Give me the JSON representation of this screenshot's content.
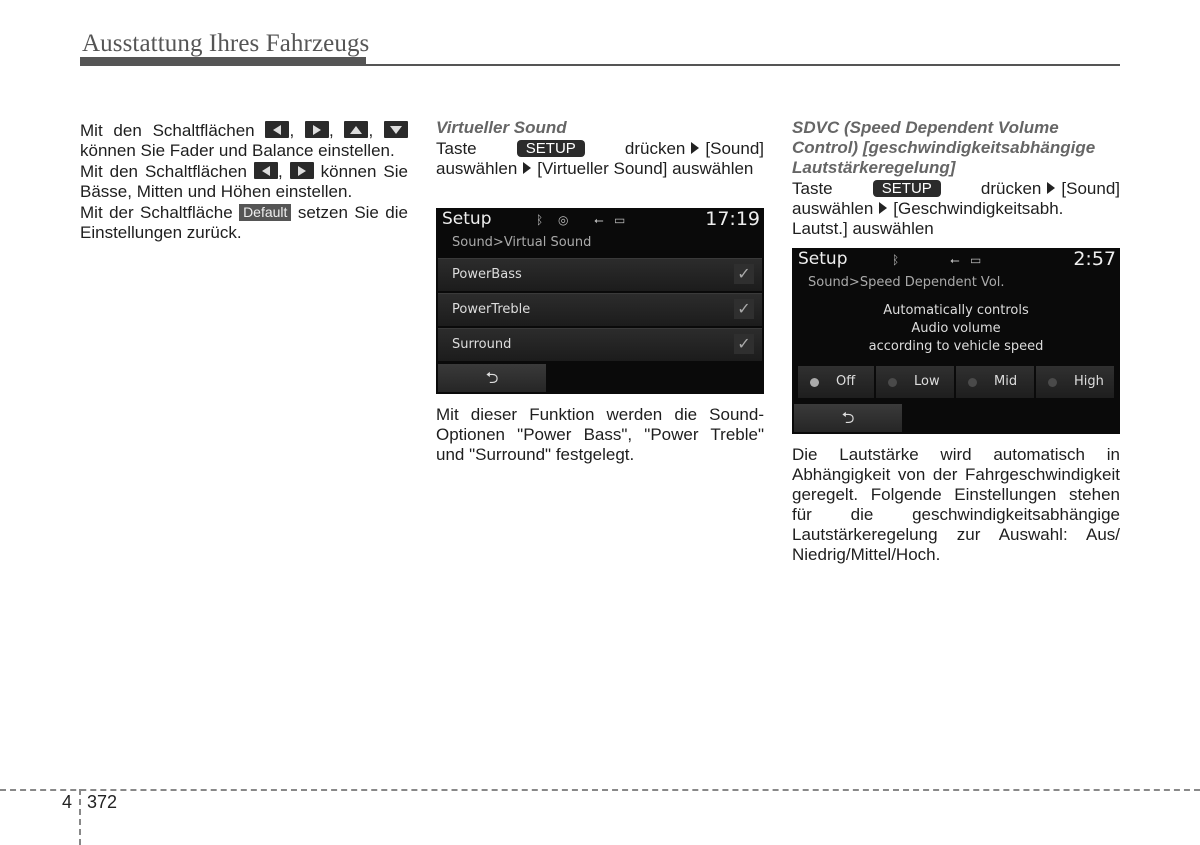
{
  "header": {
    "title": "Ausstattung Ihres Fahrzeugs"
  },
  "col1": {
    "p1_pre": "Mit den Schaltflächen",
    "p1_post": "können Sie Fader und Balance einstellen.",
    "p2_pre": "Mit den Schaltflächen",
    "p2_post": "können Sie Bässe, Mitten und Höhen einstellen.",
    "p3_pre": "Mit der Schaltfläche",
    "default_label": "Default",
    "p3_post": "setzen Sie die Einstellungen zurück.",
    "sep": ","
  },
  "col2": {
    "subtitle": "Virtueller Sound",
    "instr_taste": "Taste",
    "setup_label": "SETUP",
    "instr_1": "drücken",
    "instr_2": "[Sound] auswählen",
    "instr_3": "[Virtueller Sound] auswählen",
    "description": "Mit dieser Funktion werden die Sound-Optionen \"Power Bass\", \"Power Treble\" und \"Surround\" festgelegt."
  },
  "screen1": {
    "title": "Setup",
    "time": "17:19",
    "path": "Sound>Virtual Sound",
    "items": [
      {
        "label": "PowerBass",
        "checked": true
      },
      {
        "label": "PowerTreble",
        "checked": true
      },
      {
        "label": "Surround",
        "checked": true
      }
    ],
    "check_glyph": "✓",
    "back_glyph": "⮌"
  },
  "col3": {
    "subtitle": "SDVC (Speed Dependent Volume Control) [geschwindigkeitsabhängige Lautstärkeregelung]",
    "instr_taste": "Taste",
    "setup_label": "SETUP",
    "instr_1": "drücken",
    "instr_2": "[Sound] auswählen",
    "instr_3": "[Geschwindigkeitsabh. Lautst.] auswählen",
    "description": "Die Lautstärke wird automatisch in Abhängigkeit von der Fahrgeschwindigkeit geregelt. Folgende Einstellungen stehen für die geschwindigkeitsabhängige Lautstärkeregelung zur Auswahl: Aus/ Niedrig/Mittel/Hoch."
  },
  "screen2": {
    "title": "Setup",
    "time": "2:57",
    "path": "Sound>Speed Dependent Vol.",
    "message": [
      "Automatically controls",
      "Audio volume",
      "according to vehicle speed"
    ],
    "options": [
      {
        "label": "Off",
        "selected": true
      },
      {
        "label": "Low",
        "selected": false
      },
      {
        "label": "Mid",
        "selected": false
      },
      {
        "label": "High",
        "selected": false
      }
    ],
    "back_glyph": "⮌"
  },
  "footer": {
    "chapter": "4",
    "page": "372"
  }
}
